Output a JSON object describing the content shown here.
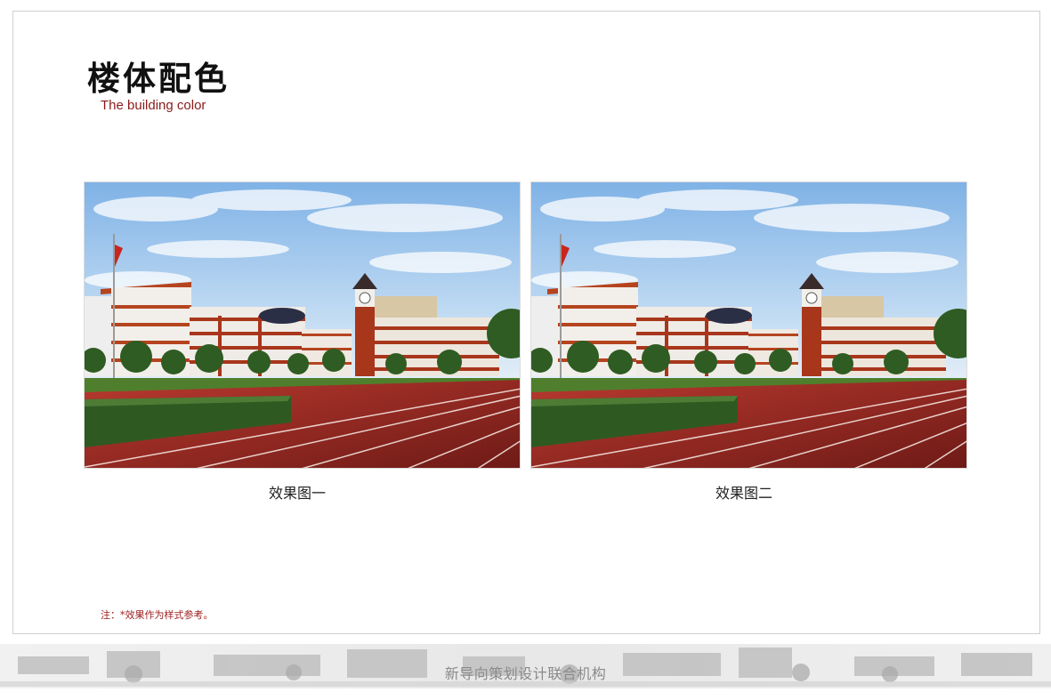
{
  "page": {
    "title_cn": "楼体配色",
    "title_en": "The building color"
  },
  "gallery": [
    {
      "caption": "效果图一"
    },
    {
      "caption": "效果图二"
    }
  ],
  "note": "注：*效果作为样式参考。",
  "footer": {
    "text": "新导向策划设计联合机构"
  },
  "colors": {
    "title_en": "#8b1a1a",
    "note": "#9b1b1b",
    "track": "#a5302a",
    "roof_accent": "#b5441f"
  }
}
